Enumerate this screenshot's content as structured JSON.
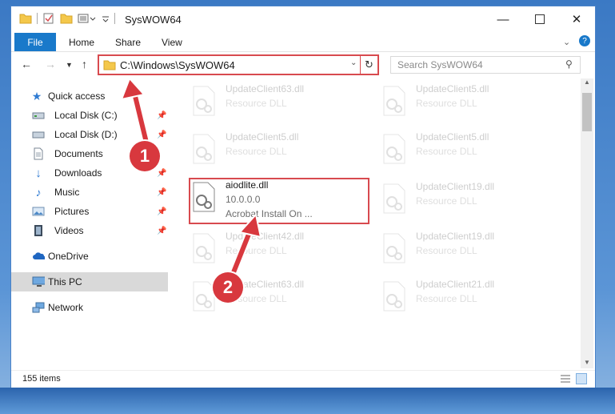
{
  "window": {
    "title": "SysWOW64"
  },
  "ribbon": {
    "file": "File",
    "tabs": [
      "Home",
      "Share",
      "View"
    ]
  },
  "nav": {
    "address": "C:\\Windows\\SysWOW64",
    "search_placeholder": "Search SysWOW64"
  },
  "sidebar": {
    "items": [
      {
        "label": "Quick access",
        "icon": "star-icon"
      },
      {
        "label": "Local Disk (C:)",
        "icon": "drive-icon"
      },
      {
        "label": "Local Disk (D:)",
        "icon": "drive-icon"
      },
      {
        "label": "Documents",
        "icon": "documents-icon"
      },
      {
        "label": "Downloads",
        "icon": "download-icon"
      },
      {
        "label": "Music",
        "icon": "music-icon"
      },
      {
        "label": "Pictures",
        "icon": "pictures-icon"
      },
      {
        "label": "Videos",
        "icon": "videos-icon"
      },
      {
        "label": "OneDrive",
        "icon": "cloud-icon"
      },
      {
        "label": "This PC",
        "icon": "computer-icon"
      },
      {
        "label": "Network",
        "icon": "network-icon"
      }
    ]
  },
  "files": {
    "left": [
      {
        "name": "UpdateClient63.dll",
        "type": "Resource DLL"
      },
      {
        "name": "UpdateClient5.dll",
        "type": "Resource DLL"
      },
      {
        "name": "aiodlite.dll",
        "version": "10.0.0.0",
        "desc": "Acrobat Install On ..."
      },
      {
        "name": "UpdateClient42.dll",
        "type": "Resource DLL"
      },
      {
        "name": "UpdateClient63.dll",
        "type": "Resource DLL"
      }
    ],
    "right": [
      {
        "name": "UpdateClient5.dll",
        "type": "Resource DLL"
      },
      {
        "name": "UpdateClient5.dll",
        "type": "Resource DLL"
      },
      {
        "name": "UpdateClient19.dll",
        "type": "Resource DLL"
      },
      {
        "name": "UpdateClient19.dll",
        "type": "Resource DLL"
      },
      {
        "name": "UpdateClient21.dll",
        "type": "Resource DLL"
      }
    ]
  },
  "status": {
    "count": "155 items"
  },
  "callouts": {
    "one": "1",
    "two": "2"
  },
  "colors": {
    "accent": "#1979ca",
    "highlight": "#d84a4f",
    "callout": "#d8383e"
  }
}
